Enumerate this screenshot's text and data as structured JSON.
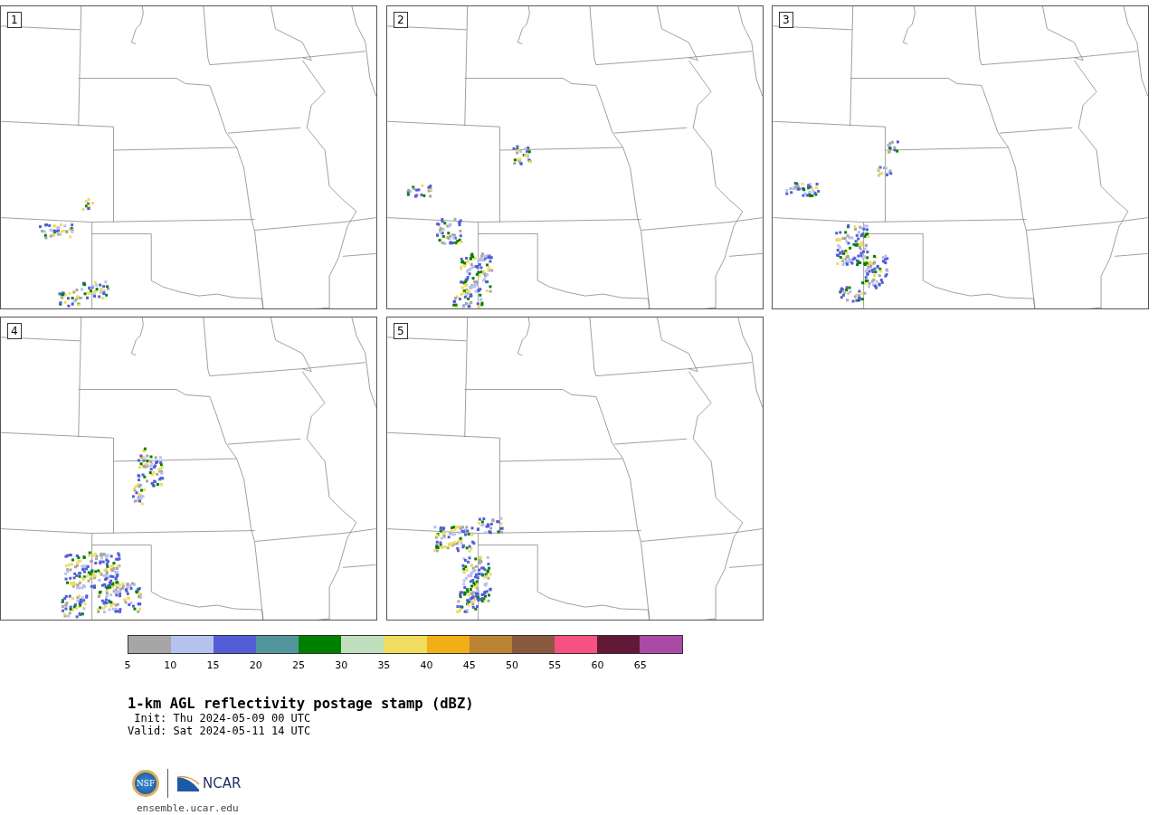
{
  "panels": [
    {
      "label": "1"
    },
    {
      "label": "2"
    },
    {
      "label": "3"
    },
    {
      "label": "4"
    },
    {
      "label": "5"
    }
  ],
  "colorbar": {
    "segments": [
      {
        "color": "#a6a6a6"
      },
      {
        "color": "#b6c2ee"
      },
      {
        "color": "#525ed6"
      },
      {
        "color": "#50969c"
      },
      {
        "color": "#008000"
      },
      {
        "color": "#bfdfbe"
      },
      {
        "color": "#f0dc5e"
      },
      {
        "color": "#f0ae17"
      },
      {
        "color": "#ba8432"
      },
      {
        "color": "#8a5a3e"
      },
      {
        "color": "#f65180"
      },
      {
        "color": "#621938"
      },
      {
        "color": "#ab4aa6"
      }
    ],
    "ticks": [
      "5",
      "10",
      "15",
      "20",
      "25",
      "30",
      "35",
      "40",
      "45",
      "50",
      "55",
      "60",
      "65"
    ]
  },
  "title": "1-km AGL reflectivity postage stamp (dBZ)",
  "init": " Init: Thu 2024-05-09 00 UTC",
  "valid": "Valid: Sat 2024-05-11 14 UTC",
  "logo": {
    "left": "NSF",
    "right": "NCAR"
  },
  "url": "ensemble.ucar.edu"
}
